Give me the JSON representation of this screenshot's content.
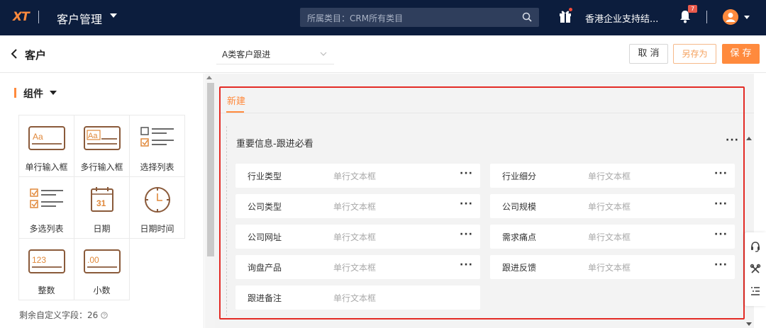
{
  "topbar": {
    "logo": "XT",
    "app_title": "客户管理",
    "search_placeholder": "所属类目：CRM所有类目",
    "company": "香港企业支持结...",
    "notification_count": "7"
  },
  "subheader": {
    "back_title": "客户",
    "template": "A类客户跟进",
    "cancel_label": "取 消",
    "saveas_label": "另存为",
    "save_label": "保 存"
  },
  "components": {
    "title": "组件",
    "items": [
      {
        "label": "单行输入框",
        "icon": "single-line-input-icon"
      },
      {
        "label": "多行输入框",
        "icon": "multi-line-input-icon"
      },
      {
        "label": "选择列表",
        "icon": "select-list-icon"
      },
      {
        "label": "多选列表",
        "icon": "multi-select-list-icon"
      },
      {
        "label": "日期",
        "icon": "date-icon"
      },
      {
        "label": "日期时间",
        "icon": "datetime-icon"
      },
      {
        "label": "整数",
        "icon": "integer-icon"
      },
      {
        "label": "小数",
        "icon": "decimal-icon"
      }
    ],
    "remaining_text": "剩余自定义字段：26"
  },
  "form": {
    "tab": "新建",
    "group_title": "重要信息-跟进必看",
    "fields": [
      {
        "label": "行业类型",
        "type": "单行文本框"
      },
      {
        "label": "行业细分",
        "type": "单行文本框"
      },
      {
        "label": "公司类型",
        "type": "单行文本框"
      },
      {
        "label": "公司规模",
        "type": "单行文本框"
      },
      {
        "label": "公司网址",
        "type": "单行文本框"
      },
      {
        "label": "需求痛点",
        "type": "单行文本框"
      },
      {
        "label": "询盘产品",
        "type": "单行文本框"
      },
      {
        "label": "跟进反馈",
        "type": "单行文本框"
      },
      {
        "label": "跟进备注",
        "type": "单行文本框"
      }
    ]
  },
  "colors": {
    "accent": "#ff8a3d",
    "nav_bg": "#0c1d3d",
    "highlight_frame": "#e32b25"
  }
}
